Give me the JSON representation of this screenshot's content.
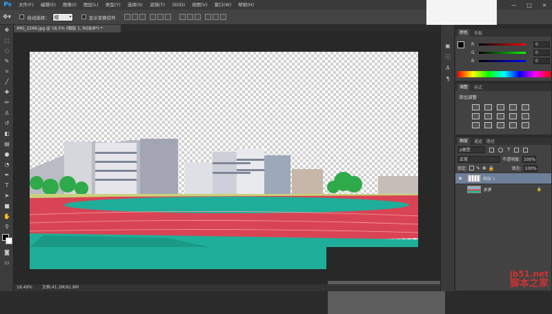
{
  "app": {
    "logo": "Ps"
  },
  "menu": [
    "文件(F)",
    "编辑(E)",
    "图像(I)",
    "图层(L)",
    "类型(Y)",
    "选择(S)",
    "滤镜(T)",
    "3D(D)",
    "视图(V)",
    "窗口(W)",
    "帮助(H)"
  ],
  "window_controls": [
    "—",
    "□",
    "×"
  ],
  "options": {
    "auto_select_label": "自动选择：",
    "auto_select_value": "组",
    "show_transform_label": "显示变换控件"
  },
  "document": {
    "tab_title": "IMG_2266.jpg @ 18.5% (图层 1, RGB/8*) *"
  },
  "status": {
    "zoom": "18.49%",
    "doc_info": "文档:41.2M/91.8M"
  },
  "panels": {
    "color": {
      "tabs": [
        "颜色",
        "色板"
      ],
      "channels": [
        {
          "label": "R",
          "value": "0"
        },
        {
          "label": "G",
          "value": "0"
        },
        {
          "label": "B",
          "value": "0"
        }
      ]
    },
    "adjustments": {
      "tabs": [
        "调整",
        "样式"
      ],
      "title": "添加调整"
    },
    "layers": {
      "tabs": [
        "图层",
        "通道",
        "路径"
      ],
      "filter_label": "ρ类型",
      "blend_mode": "正常",
      "opacity_label": "不透明度:",
      "opacity_value": "100%",
      "lock_label": "锁定:",
      "fill_label": "填充:",
      "fill_value": "100%",
      "items": [
        {
          "name": "图层 1",
          "selected": true
        },
        {
          "name": "背景",
          "selected": false
        }
      ]
    }
  },
  "watermark": {
    "top": "jb51.net",
    "bottom": "脚本之家"
  },
  "colors": {
    "menubar": "#3a3a3a",
    "panel": "#424242",
    "track": "#d94454",
    "field": "#1fae9a",
    "selected_layer": "#6e7f9a"
  }
}
